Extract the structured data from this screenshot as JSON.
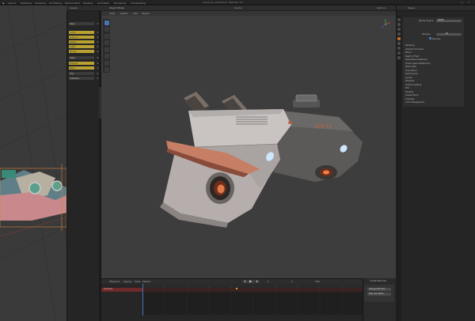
{
  "app": {
    "title": "robot_mk_v04.blend - Blender 3.5",
    "menus": [
      "Layout",
      "Modeling",
      "Sculpting",
      "UV Editing",
      "Texture Paint",
      "Shading",
      "Animation",
      "Rendering",
      "Compositing"
    ]
  },
  "left_viewport": {
    "header_label": "Object Mode",
    "layers_label": "Layers"
  },
  "layers": {
    "rows": [
      {
        "label": "Body",
        "highlight": false
      },
      {
        "label": "Armor",
        "highlight": true
      },
      {
        "label": "Armor_2",
        "highlight": true
      },
      {
        "label": "Details",
        "highlight": true
      },
      {
        "label": "Lights",
        "highlight": true
      },
      {
        "label": "Decals",
        "highlight": true
      },
      {
        "label": "Glass",
        "highlight": false
      },
      {
        "label": "Exhaust",
        "highlight": true
      },
      {
        "label": "Panel",
        "highlight": true
      },
      {
        "label": "Fins",
        "highlight": false
      },
      {
        "label": "Collection",
        "highlight": false
      }
    ]
  },
  "main_viewport": {
    "header_label": "Object Mode",
    "menus": [
      "View",
      "Select",
      "Add",
      "Object"
    ],
    "shading_label": "Global",
    "overlay_label": "Options"
  },
  "properties": {
    "tab_label": "Scene",
    "header_fields": [
      {
        "label": "Render Engine",
        "value": "EEVEE"
      },
      {
        "label": "Samples",
        "value": "64"
      }
    ],
    "checkbox_label": "Denoise",
    "sections": [
      "Sampling",
      "Ambient Occlusion",
      "Bloom",
      "Depth of Field",
      "Subsurface Scattering",
      "Screen Space Reflections",
      "Motion Blur",
      "Volumetrics",
      "Performance",
      "Curves",
      "Shadows",
      "Indirect Lighting",
      "Film",
      "Simplify",
      "Grease Pencil",
      "Freestyle",
      "Color Management"
    ]
  },
  "timeline": {
    "menus": [
      "Playback",
      "Keying",
      "View",
      "Marker"
    ],
    "frame_current": "1",
    "frame_start": "1",
    "frame_end": "250",
    "side_title": "Create Fake User",
    "side_buttons": [
      "Change Fake User",
      "Fake User Name"
    ],
    "red_track_label": "Summary"
  },
  "colors": {
    "accent": "#4772b3",
    "layer_highlight": "#b9a232",
    "active_tab": "#c06a2a"
  }
}
